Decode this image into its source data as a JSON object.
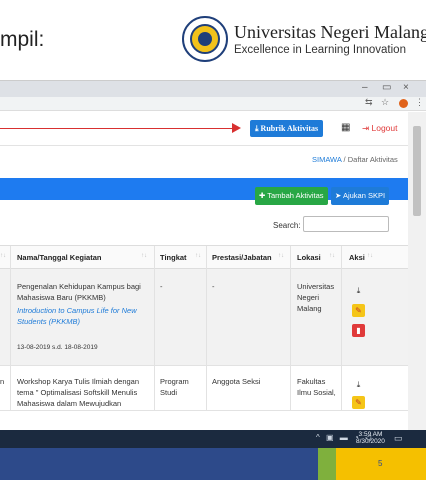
{
  "slide": {
    "heading": "mpil:",
    "university_name": "Universitas Negeri Malang",
    "university_tagline": "Excellence in Learning Innovation",
    "page_number": "5"
  },
  "browser": {
    "controls": {
      "minimize": "–",
      "maximize": "▭",
      "close": "×"
    },
    "addr_icons": [
      "⇆",
      "☆",
      "⋮"
    ]
  },
  "navbar": {
    "rubrik_label": "Rubrik Aktivitas",
    "grid_icon": "▦",
    "logout_label": "Logout"
  },
  "breadcrumb": {
    "root": "SIMAWA",
    "separator": "/",
    "current": "Daftar Aktivitas"
  },
  "actions": {
    "tambah_label": "Tambah Aktivitas",
    "ajukan_label": "Ajukan SKPI"
  },
  "search": {
    "label": "Search:",
    "value": ""
  },
  "table": {
    "headers": [
      "Nama/Tanggal Kegiatan",
      "Tingkat",
      "Prestasi/Jabatan",
      "Lokasi",
      "Aksi"
    ],
    "sort_glyph": "↑↓",
    "rows": [
      {
        "left_fragment": "",
        "title": "Pengenalan Kehidupan Kampus bagi Mahasiswa Baru (PKKMB)",
        "subtitle": "Introduction to Campus Life for New Students (PKKMB)",
        "date": "13-08-2019 s.d. 18-08-2019",
        "tingkat": "-",
        "prestasi": "-",
        "lokasi": "Universitas Negeri Malang"
      },
      {
        "left_fragment": "n",
        "title": "Workshop Karya Tulis Ilmiah dengan tema \" Optimalisasi Softskill Menulis Mahasiswa dalam Mewujudkan",
        "subtitle": "",
        "date": "",
        "tingkat": "Program Studi",
        "prestasi": "Anggota Seksi",
        "lokasi": "Fakultas Ilmu Sosial,"
      }
    ]
  },
  "taskbar": {
    "time": "3:59 AM",
    "date": "8/30/2020"
  },
  "colors": {
    "primary": "#1e7bd8",
    "band": "#1e7bf0",
    "success": "#28a745",
    "danger": "#e03a3a",
    "warning": "#f5c518",
    "footer": "#2d4a8a"
  },
  "icons": {
    "rubrik": "download-icon",
    "logout": "logout-icon",
    "tambah": "plus-icon",
    "ajukan": "send-icon",
    "row_download": "download-icon",
    "row_edit": "edit-icon",
    "row_delete": "trash-icon"
  }
}
